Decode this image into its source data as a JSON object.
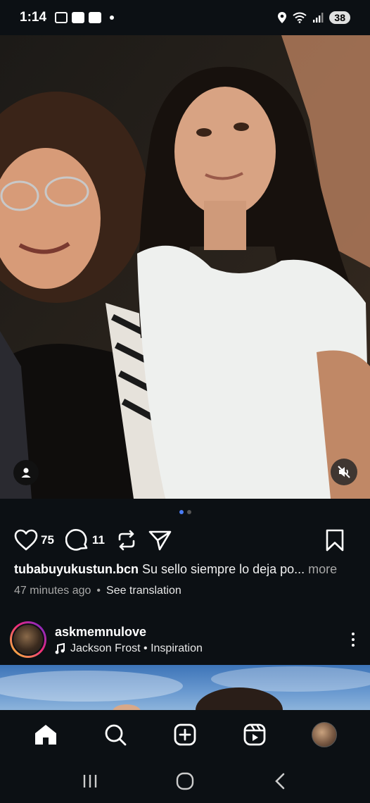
{
  "status_bar": {
    "time": "1:14",
    "battery": "38",
    "left_icons": [
      "screen-record-icon",
      "youtube-icon",
      "app-icon",
      "notification-dot-icon"
    ],
    "right_icons": [
      "location-icon",
      "wifi-icon",
      "signal-icon",
      "battery-icon"
    ]
  },
  "post": {
    "media_description_icons": [
      "user-tag-icon",
      "mute-icon"
    ],
    "pager": {
      "count": 2,
      "active": 0
    },
    "likes": "75",
    "comments": "11",
    "username": "tubabuyukustun.bcn",
    "caption": "Su sello siempre lo deja po...",
    "more": "more",
    "time_ago": "47 minutes ago",
    "separator": "•",
    "see_translation": "See translation"
  },
  "next_post": {
    "username": "askmemnulove",
    "audio": "Jackson Frost • Inspiration"
  },
  "tab_bar": {
    "tabs": [
      "home-icon",
      "search-icon",
      "create-icon",
      "reels-icon",
      "profile-avatar"
    ]
  },
  "system_nav": {
    "buttons": [
      "recents-icon",
      "home-circle-icon",
      "back-icon"
    ]
  },
  "colors": {
    "background": "#0c1014",
    "pager_active": "#4a7cf5",
    "muted_text": "#a8a8a8"
  }
}
